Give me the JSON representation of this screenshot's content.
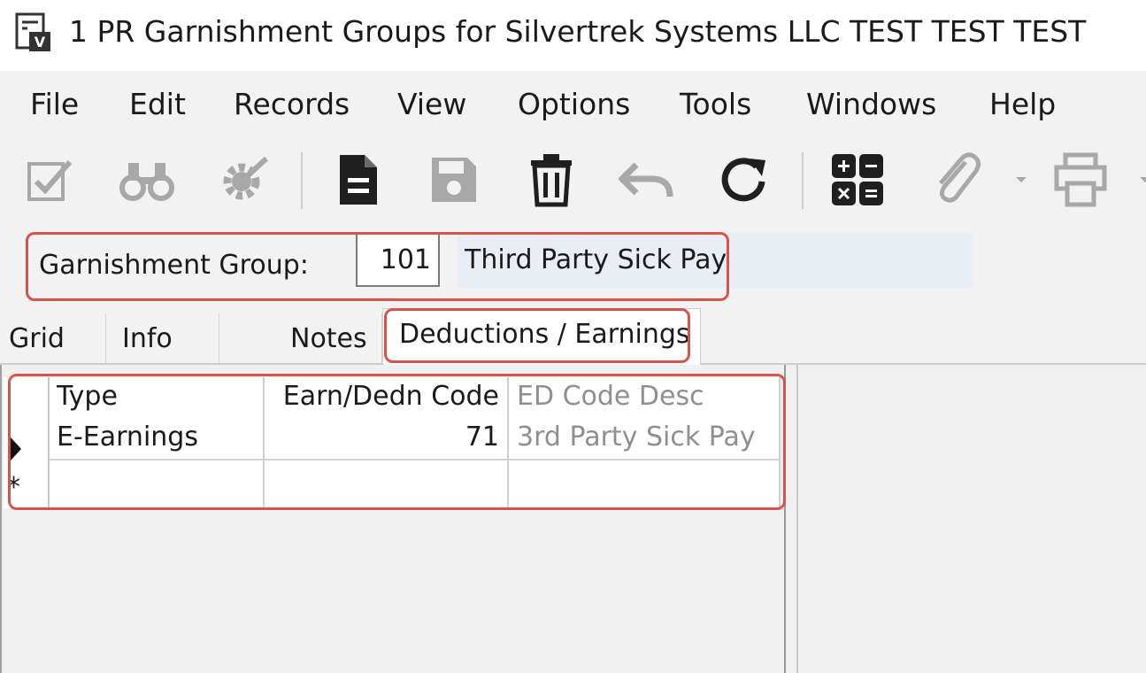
{
  "window": {
    "title": "1 PR Garnishment Groups for Silvertrek Systems LLC TEST TEST TEST",
    "icon": "form-icon"
  },
  "menu": {
    "items": [
      "File",
      "Edit",
      "Records",
      "View",
      "Options",
      "Tools",
      "Windows",
      "Help"
    ]
  },
  "toolbar": {
    "buttons": [
      "validate-icon",
      "find-icon",
      "settings-icon",
      "new-record-icon",
      "save-icon",
      "delete-icon",
      "undo-icon",
      "refresh-icon",
      "calculator-icon",
      "attachment-icon",
      "print-icon"
    ]
  },
  "header": {
    "label": "Garnishment Group:",
    "group_number": "101",
    "group_description": "Third Party Sick Pay"
  },
  "tabs": [
    {
      "label": "Grid",
      "active": false
    },
    {
      "label": "Info",
      "active": false
    },
    {
      "label": "Notes",
      "active": false
    },
    {
      "label": "Deductions / Earnings",
      "active": true
    }
  ],
  "grid": {
    "columns": [
      "Type",
      "Earn/Dedn Code",
      "ED Code Desc"
    ],
    "rows": [
      {
        "type": "E-Earnings",
        "code": "71",
        "desc": "3rd Party Sick Pay"
      }
    ],
    "new_row_marker": "*"
  },
  "colors": {
    "highlight": "#d9534a",
    "chrome": "#f2f2f2",
    "desc_field": "#e8eef4",
    "muted_text": "#8f8f8f"
  }
}
